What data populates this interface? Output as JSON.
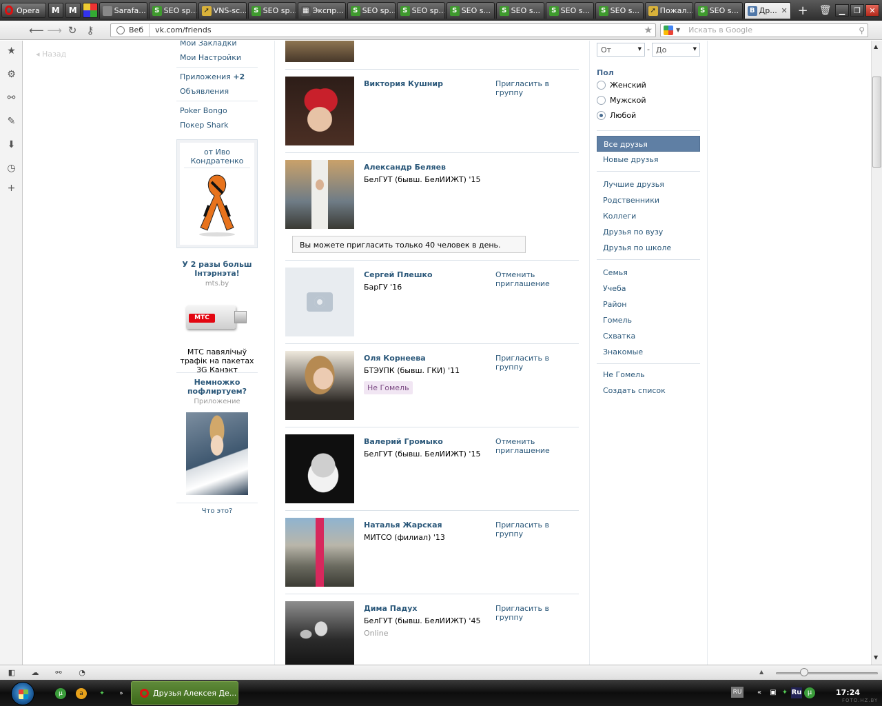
{
  "browser": {
    "menu_label": "Opera",
    "speed_dial": [
      "M",
      "M"
    ],
    "tabs": [
      {
        "label": "Sarafa...",
        "icon": "page-icon"
      },
      {
        "label": "SEO sp...",
        "icon": "s-icon"
      },
      {
        "label": "VNS-sc...",
        "icon": "cursor-icon"
      },
      {
        "label": "SEO sp...",
        "icon": "s-icon"
      },
      {
        "label": "Экспр...",
        "icon": "grid-icon"
      },
      {
        "label": "SEO sp...",
        "icon": "s-icon"
      },
      {
        "label": "SEO sp...",
        "icon": "s-icon"
      },
      {
        "label": "SEO s...",
        "icon": "s-icon"
      },
      {
        "label": "SEO s...",
        "icon": "s-icon"
      },
      {
        "label": "SEO s...",
        "icon": "s-icon"
      },
      {
        "label": "SEO s...",
        "icon": "s-icon"
      },
      {
        "label": "Пожал...",
        "icon": "cursor-icon"
      },
      {
        "label": "SEO s...",
        "icon": "s-icon"
      }
    ],
    "active_tab": {
      "label": "Др...",
      "icon_letter": "В"
    },
    "address": {
      "site_label": "Веб",
      "url": "vk.com/friends"
    },
    "search": {
      "placeholder": "Искать в Google"
    }
  },
  "page": {
    "back_label": "Назад",
    "left_menu": [
      {
        "label": "Мои Закладки"
      },
      {
        "label": "Мои Настройки"
      },
      {
        "label": "Приложения",
        "count": "+2"
      },
      {
        "label": "Объявления"
      },
      {
        "label": "Poker Bongo"
      },
      {
        "label": "Покер Shark"
      }
    ],
    "gift": {
      "title": "от Иво Кондратенко"
    },
    "ads": [
      {
        "title": "У 2 разы больш Інтэрнэта!",
        "domain": "mts.by",
        "brand": "МТС",
        "text": "МТС павялічыў трафік на пакетах 3G Канэкт"
      },
      {
        "title": "Немножко пофлиртуем?",
        "domain": "Приложение"
      }
    ],
    "what_is_this": "Что это?",
    "limit_notice": "Вы можете пригласить только 40 человек в день.",
    "friends": [
      {
        "name": "Виктория Кушнир",
        "sub": "",
        "action": "Пригласить в группу",
        "avatar": "photo"
      },
      {
        "name": "Александр Беляев",
        "sub": "БелГУТ (бывш. БелИИЖТ) '15",
        "action": "",
        "avatar": "photo"
      },
      {
        "name": "Сергей Плешко",
        "sub": "БарГУ '16",
        "action": "Отменить приглашение",
        "avatar": "camera-placeholder"
      },
      {
        "name": "Оля Корнеева",
        "sub": "БТЭУПК (бывш. ГКИ) '11",
        "tag": "Не Гомель",
        "action": "Пригласить в группу",
        "avatar": "photo"
      },
      {
        "name": "Валерий Громыко",
        "sub": "БелГУТ (бывш. БелИИЖТ) '15",
        "action": "Отменить приглашение",
        "avatar": "photo"
      },
      {
        "name": "Наталья Жарская",
        "sub": "МИТСО (филиал) '13",
        "action": "Пригласить в группу",
        "avatar": "photo"
      },
      {
        "name": "Дима Падух",
        "sub": "БелГУТ (бывш. БелИИЖТ) '45",
        "status": "Online",
        "action": "Пригласить в группу",
        "avatar": "photo"
      }
    ],
    "filters": {
      "age_from": "От",
      "age_to": "До",
      "sex_title": "Пол",
      "sex_options": [
        {
          "label": "Женский",
          "checked": false
        },
        {
          "label": "Мужской",
          "checked": false
        },
        {
          "label": "Любой",
          "checked": true
        }
      ]
    },
    "lists": {
      "group1": [
        {
          "label": "Все друзья",
          "selected": true
        },
        {
          "label": "Новые друзья",
          "selected": false
        }
      ],
      "group2": [
        "Лучшие друзья",
        "Родственники",
        "Коллеги",
        "Друзья по вузу",
        "Друзья по школе"
      ],
      "group3": [
        "Семья",
        "Учеба",
        "Район",
        "Гомель",
        "Схватка",
        "Знакомые"
      ],
      "group4": [
        "Не Гомель",
        "Создать список"
      ]
    }
  },
  "taskbar": {
    "task_label": "Друзья Алексея Де...",
    "lang": "RU",
    "tray_lang": "Ru",
    "clock": "17:24"
  },
  "watermark": "FOTO.HZ.BY",
  "colors": {
    "vk_link": "#2b587a",
    "vk_selected": "#5f7fa4",
    "tag_bg": "#f1e6f3",
    "taskbar_active": "#4f7a2a"
  }
}
